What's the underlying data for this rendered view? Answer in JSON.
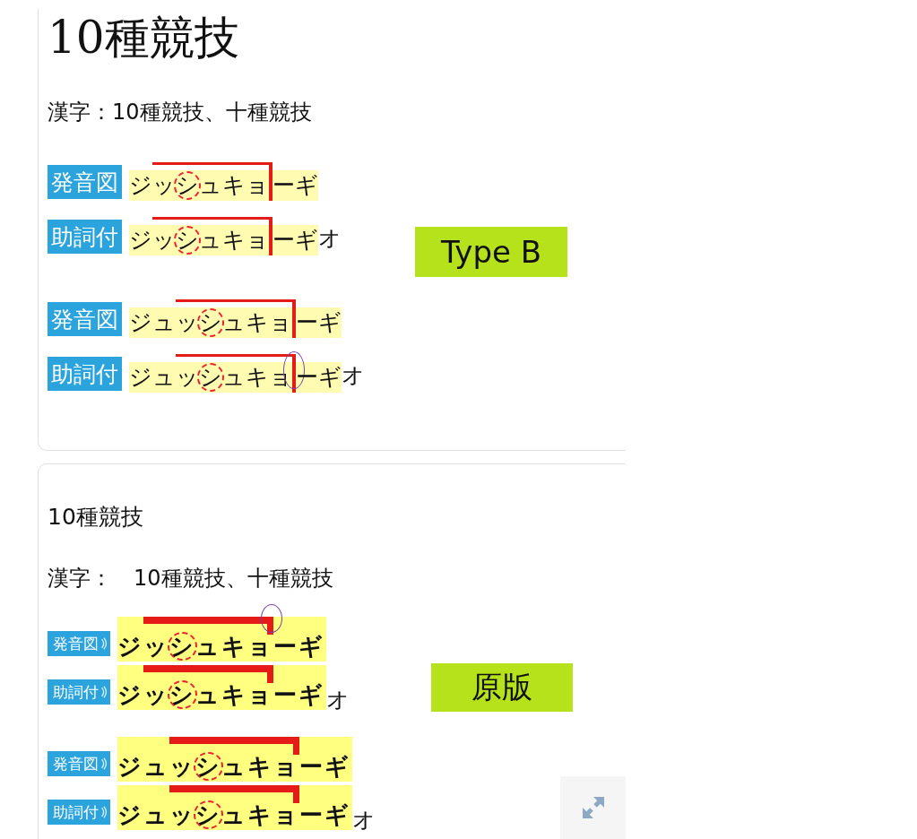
{
  "cards": [
    {
      "kind": "modern",
      "title": "10種競技",
      "kanji": "漢字：10種競技、十種競技",
      "tag": "Type B",
      "groups": [
        {
          "rows": [
            {
              "label": "発音図",
              "particle": null,
              "morae": [
                {
                  "text": "ジ",
                  "high": false,
                  "devoiced": false,
                  "drop": false,
                  "circled": false
                },
                {
                  "text": "ッ",
                  "high": true,
                  "devoiced": false,
                  "drop": false,
                  "circled": false
                },
                {
                  "text": "シ",
                  "high": true,
                  "devoiced": true,
                  "drop": false,
                  "circled": false
                },
                {
                  "text": "ュ",
                  "high": true,
                  "devoiced": false,
                  "drop": false,
                  "circled": false
                },
                {
                  "text": "キ",
                  "high": true,
                  "devoiced": false,
                  "drop": false,
                  "circled": false
                },
                {
                  "text": "ョ",
                  "high": true,
                  "devoiced": false,
                  "drop": true,
                  "circled": false
                },
                {
                  "text": "ー",
                  "high": false,
                  "devoiced": false,
                  "drop": false,
                  "circled": false
                },
                {
                  "text": "ギ",
                  "high": false,
                  "devoiced": false,
                  "drop": false,
                  "circled": false
                }
              ]
            },
            {
              "label": "助詞付",
              "particle": "オ",
              "morae": [
                {
                  "text": "ジ",
                  "high": false,
                  "devoiced": false,
                  "drop": false,
                  "circled": false
                },
                {
                  "text": "ッ",
                  "high": true,
                  "devoiced": false,
                  "drop": false,
                  "circled": false
                },
                {
                  "text": "シ",
                  "high": true,
                  "devoiced": true,
                  "drop": false,
                  "circled": false
                },
                {
                  "text": "ュ",
                  "high": true,
                  "devoiced": false,
                  "drop": false,
                  "circled": false
                },
                {
                  "text": "キ",
                  "high": true,
                  "devoiced": false,
                  "drop": false,
                  "circled": false
                },
                {
                  "text": "ョ",
                  "high": true,
                  "devoiced": false,
                  "drop": true,
                  "circled": false
                },
                {
                  "text": "ー",
                  "high": false,
                  "devoiced": false,
                  "drop": false,
                  "circled": false
                },
                {
                  "text": "ギ",
                  "high": false,
                  "devoiced": false,
                  "drop": false,
                  "circled": false
                }
              ]
            }
          ]
        },
        {
          "rows": [
            {
              "label": "発音図",
              "particle": null,
              "morae": [
                {
                  "text": "ジ",
                  "high": false,
                  "devoiced": false,
                  "drop": false,
                  "circled": false
                },
                {
                  "text": "ュ",
                  "high": false,
                  "devoiced": false,
                  "drop": false,
                  "circled": false
                },
                {
                  "text": "ッ",
                  "high": true,
                  "devoiced": false,
                  "drop": false,
                  "circled": false
                },
                {
                  "text": "シ",
                  "high": true,
                  "devoiced": true,
                  "drop": false,
                  "circled": false
                },
                {
                  "text": "ュ",
                  "high": true,
                  "devoiced": false,
                  "drop": false,
                  "circled": false
                },
                {
                  "text": "キ",
                  "high": true,
                  "devoiced": false,
                  "drop": false,
                  "circled": false
                },
                {
                  "text": "ョ",
                  "high": true,
                  "devoiced": false,
                  "drop": true,
                  "circled": false
                },
                {
                  "text": "ー",
                  "high": false,
                  "devoiced": false,
                  "drop": false,
                  "circled": false
                },
                {
                  "text": "ギ",
                  "high": false,
                  "devoiced": false,
                  "drop": false,
                  "circled": false
                }
              ]
            },
            {
              "label": "助詞付",
              "particle": "オ",
              "morae": [
                {
                  "text": "ジ",
                  "high": false,
                  "devoiced": false,
                  "drop": false,
                  "circled": false
                },
                {
                  "text": "ュ",
                  "high": false,
                  "devoiced": false,
                  "drop": false,
                  "circled": false
                },
                {
                  "text": "ッ",
                  "high": true,
                  "devoiced": false,
                  "drop": false,
                  "circled": false
                },
                {
                  "text": "シ",
                  "high": true,
                  "devoiced": true,
                  "drop": false,
                  "circled": false
                },
                {
                  "text": "ュ",
                  "high": true,
                  "devoiced": false,
                  "drop": false,
                  "circled": false
                },
                {
                  "text": "キ",
                  "high": true,
                  "devoiced": false,
                  "drop": false,
                  "circled": false
                },
                {
                  "text": "ョ",
                  "high": true,
                  "devoiced": false,
                  "drop": true,
                  "circled": true
                },
                {
                  "text": "ー",
                  "high": false,
                  "devoiced": false,
                  "drop": false,
                  "circled": false
                },
                {
                  "text": "ギ",
                  "high": false,
                  "devoiced": false,
                  "drop": false,
                  "circled": false
                }
              ]
            }
          ]
        }
      ]
    },
    {
      "kind": "classic",
      "title": "10種競技",
      "kanji": "漢字：　10種競技、十種競技",
      "tag": "原版",
      "groups": [
        {
          "rows": [
            {
              "label": "発音図",
              "particle": null,
              "morae": [
                {
                  "text": "ジ",
                  "high": false,
                  "devoiced": false,
                  "drop": false,
                  "circled": false
                },
                {
                  "text": "ッ",
                  "high": true,
                  "devoiced": false,
                  "drop": false,
                  "circled": false
                },
                {
                  "text": "シ",
                  "high": true,
                  "devoiced": true,
                  "drop": false,
                  "circled": false
                },
                {
                  "text": "ュ",
                  "high": true,
                  "devoiced": false,
                  "drop": false,
                  "circled": false
                },
                {
                  "text": "キ",
                  "high": true,
                  "devoiced": false,
                  "drop": false,
                  "circled": false
                },
                {
                  "text": "ョ",
                  "high": true,
                  "devoiced": false,
                  "drop": true,
                  "circled": true
                },
                {
                  "text": "ー",
                  "high": false,
                  "devoiced": false,
                  "drop": false,
                  "circled": false
                },
                {
                  "text": "ギ",
                  "high": false,
                  "devoiced": false,
                  "drop": false,
                  "circled": false
                }
              ]
            },
            {
              "label": "助詞付",
              "particle": "オ",
              "morae": [
                {
                  "text": "ジ",
                  "high": false,
                  "devoiced": false,
                  "drop": false,
                  "circled": false
                },
                {
                  "text": "ッ",
                  "high": true,
                  "devoiced": false,
                  "drop": false,
                  "circled": false
                },
                {
                  "text": "シ",
                  "high": true,
                  "devoiced": true,
                  "drop": false,
                  "circled": false
                },
                {
                  "text": "ュ",
                  "high": true,
                  "devoiced": false,
                  "drop": false,
                  "circled": false
                },
                {
                  "text": "キ",
                  "high": true,
                  "devoiced": false,
                  "drop": false,
                  "circled": false
                },
                {
                  "text": "ョ",
                  "high": true,
                  "devoiced": false,
                  "drop": true,
                  "circled": false
                },
                {
                  "text": "ー",
                  "high": false,
                  "devoiced": false,
                  "drop": false,
                  "circled": false
                },
                {
                  "text": "ギ",
                  "high": false,
                  "devoiced": false,
                  "drop": false,
                  "circled": false
                }
              ]
            }
          ]
        },
        {
          "rows": [
            {
              "label": "発音図",
              "particle": null,
              "morae": [
                {
                  "text": "ジ",
                  "high": false,
                  "devoiced": false,
                  "drop": false,
                  "circled": false
                },
                {
                  "text": "ュ",
                  "high": false,
                  "devoiced": false,
                  "drop": false,
                  "circled": false
                },
                {
                  "text": "ッ",
                  "high": true,
                  "devoiced": false,
                  "drop": false,
                  "circled": false
                },
                {
                  "text": "シ",
                  "high": true,
                  "devoiced": true,
                  "drop": false,
                  "circled": false
                },
                {
                  "text": "ュ",
                  "high": true,
                  "devoiced": false,
                  "drop": false,
                  "circled": false
                },
                {
                  "text": "キ",
                  "high": true,
                  "devoiced": false,
                  "drop": false,
                  "circled": false
                },
                {
                  "text": "ョ",
                  "high": true,
                  "devoiced": false,
                  "drop": true,
                  "circled": false
                },
                {
                  "text": "ー",
                  "high": false,
                  "devoiced": false,
                  "drop": false,
                  "circled": false
                },
                {
                  "text": "ギ",
                  "high": false,
                  "devoiced": false,
                  "drop": false,
                  "circled": false
                }
              ]
            },
            {
              "label": "助詞付",
              "particle": "オ",
              "morae": [
                {
                  "text": "ジ",
                  "high": false,
                  "devoiced": false,
                  "drop": false,
                  "circled": false
                },
                {
                  "text": "ュ",
                  "high": false,
                  "devoiced": false,
                  "drop": false,
                  "circled": false
                },
                {
                  "text": "ッ",
                  "high": true,
                  "devoiced": false,
                  "drop": false,
                  "circled": false
                },
                {
                  "text": "シ",
                  "high": true,
                  "devoiced": true,
                  "drop": false,
                  "circled": false
                },
                {
                  "text": "ュ",
                  "high": true,
                  "devoiced": false,
                  "drop": false,
                  "circled": false
                },
                {
                  "text": "キ",
                  "high": true,
                  "devoiced": false,
                  "drop": false,
                  "circled": false
                },
                {
                  "text": "ョ",
                  "high": true,
                  "devoiced": false,
                  "drop": true,
                  "circled": false
                },
                {
                  "text": "ー",
                  "high": false,
                  "devoiced": false,
                  "drop": false,
                  "circled": false
                },
                {
                  "text": "ギ",
                  "high": false,
                  "devoiced": false,
                  "drop": false,
                  "circled": false
                }
              ]
            }
          ]
        }
      ]
    }
  ]
}
